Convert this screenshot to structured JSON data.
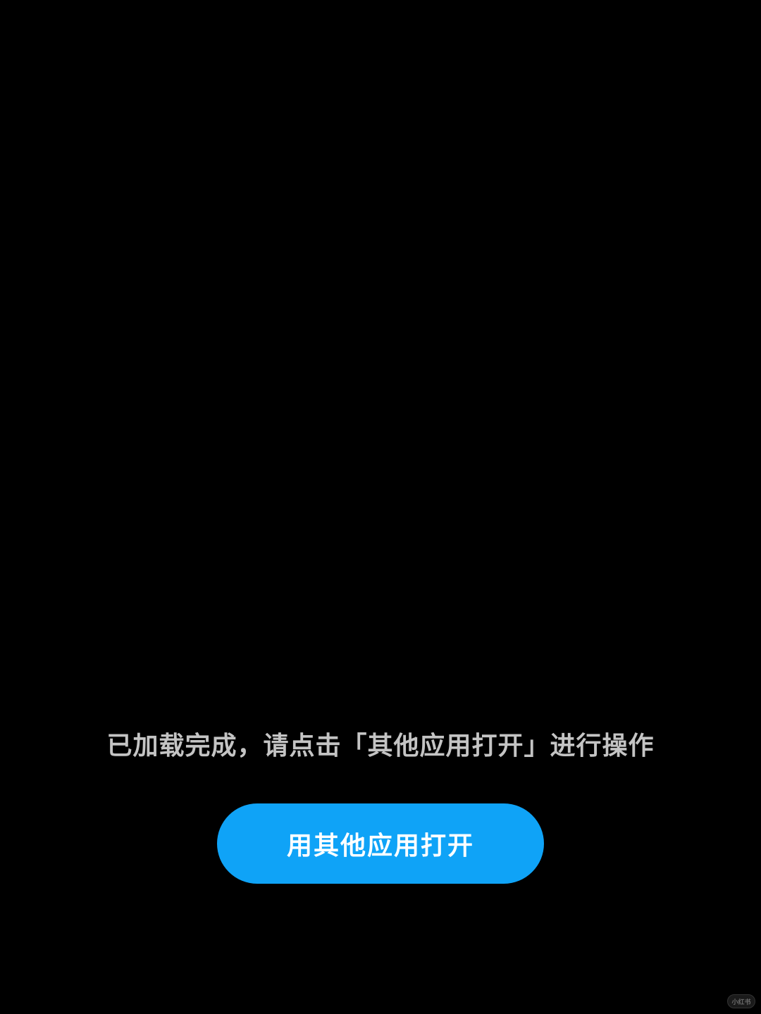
{
  "message": {
    "text": "已加载完成，请点击「其他应用打开」进行操作"
  },
  "open_button": {
    "label": "用其他应用打开"
  },
  "watermark": {
    "text": "小红书",
    "icon": "xiaohongshu-logo"
  },
  "colors": {
    "background": "#000000",
    "message_text": "#C4C4C4",
    "button_fill": "#0FA3F7",
    "button_text": "#FFFFFF"
  }
}
